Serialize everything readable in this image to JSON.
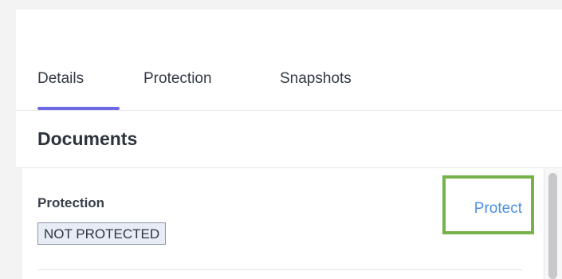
{
  "tabs": [
    {
      "label": "Details",
      "active": true
    },
    {
      "label": "Protection",
      "active": false
    },
    {
      "label": "Snapshots",
      "active": false
    }
  ],
  "section": {
    "title": "Documents"
  },
  "protection": {
    "label": "Protection",
    "status": "NOT PROTECTED",
    "action_label": "Protect"
  },
  "colors": {
    "tab_active_underline": "#6f69e6",
    "link": "#4b8fe3",
    "highlight_border": "#76b24a",
    "badge_bg": "#e8ecf4",
    "badge_border": "#8b94a5"
  }
}
